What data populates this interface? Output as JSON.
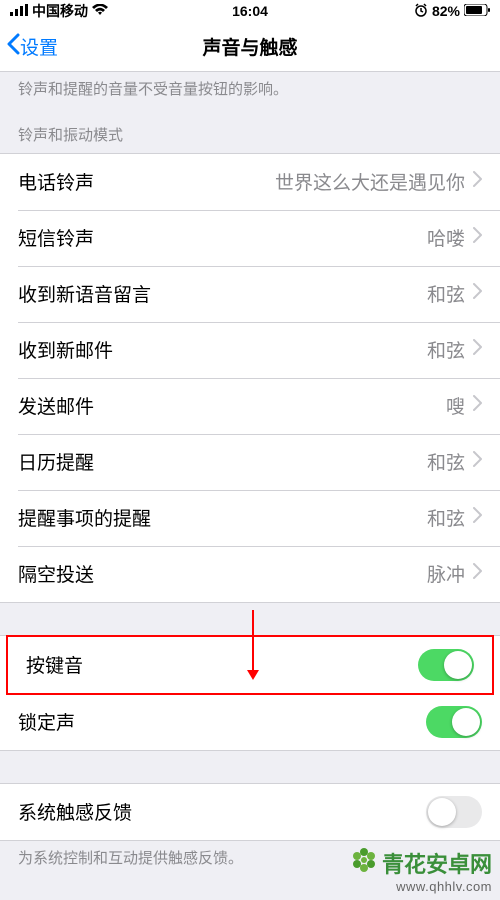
{
  "status": {
    "signal_icon": "▪▪▪▪",
    "carrier": "中国移动",
    "wifi_icon": "wifi",
    "time": "16:04",
    "alarm_icon": "alarm",
    "battery_pct": "82%",
    "battery_icon": "battery"
  },
  "nav": {
    "back_label": "设置",
    "title": "声音与触感"
  },
  "top_hint": "铃声和提醒的音量不受音量按钮的影响。",
  "section1_header": "铃声和振动模式",
  "sounds": [
    {
      "label": "电话铃声",
      "value": "世界这么大还是遇见你"
    },
    {
      "label": "短信铃声",
      "value": "哈喽"
    },
    {
      "label": "收到新语音留言",
      "value": "和弦"
    },
    {
      "label": "收到新邮件",
      "value": "和弦"
    },
    {
      "label": "发送邮件",
      "value": "嗖"
    },
    {
      "label": "日历提醒",
      "value": "和弦"
    },
    {
      "label": "提醒事项的提醒",
      "value": "和弦"
    },
    {
      "label": "隔空投送",
      "value": "脉冲"
    }
  ],
  "toggles": {
    "keyboard_clicks": {
      "label": "按键音",
      "on": true
    },
    "lock_sound": {
      "label": "锁定声",
      "on": true
    }
  },
  "haptics": {
    "label": "系统触感反馈",
    "on": false,
    "footer": "为系统控制和互动提供触感反馈。"
  },
  "watermark": {
    "brand": "青花安卓网",
    "url": "www.qhhlv.com"
  }
}
